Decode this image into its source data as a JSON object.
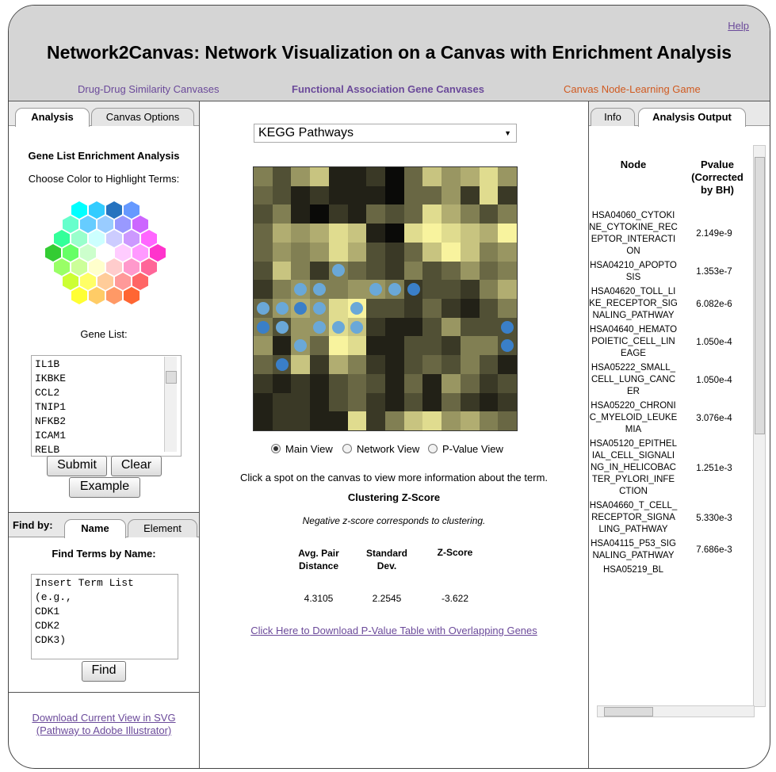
{
  "header": {
    "help": "Help",
    "title": "Network2Canvas: Network Visualization on a Canvas with Enrichment Analysis",
    "nav": [
      {
        "label": "Drug-Drug Similarity Canvases",
        "color": "#6b4a9a"
      },
      {
        "label": "Functional Association Gene Canvases",
        "color": "#6b4a9a"
      },
      {
        "label": "Canvas Node-Learning Game",
        "color": "#d05a20"
      }
    ]
  },
  "left": {
    "tabs": [
      "Analysis",
      "Canvas Options"
    ],
    "section_title": "Gene List Enrichment Analysis",
    "color_prompt": "Choose Color to Highlight Terms:",
    "gene_list_label": "Gene List:",
    "gene_list": "IL1B\nIKBKE\nCCL2\nTNIP1\nNFKB2\nICAM1\nRELB",
    "submit": "Submit",
    "clear": "Clear",
    "example": "Example",
    "find_by": "Find by:",
    "find_tabs": [
      "Name",
      "Element"
    ],
    "find_title": "Find Terms by Name:",
    "find_placeholder": "Insert Term List\n(e.g.,\nCDK1\nCDK2\nCDK3)",
    "find_button": "Find",
    "download_svg": "Download Current View in SVG",
    "download_svg_sub": "(Pathway to Adobe Illustrator)"
  },
  "center": {
    "select_value": "KEGG Pathways",
    "views": [
      "Main View",
      "Network View",
      "P-Value View"
    ],
    "selected_view": "Main View",
    "instruction": "Click a spot on the canvas to view more information about the term.",
    "clustering_title": "Clustering Z-Score",
    "clustering_note": "Negative z-score corresponds to clustering.",
    "stats_headers": [
      "Avg. Pair Distance",
      "Standard Dev.",
      "Z-Score"
    ],
    "stats_values": [
      "4.3105",
      "2.2545",
      "-3.622"
    ],
    "download_link": "Click Here to Download P-Value Table with Overlapping Genes"
  },
  "right": {
    "tabs": [
      "Info",
      "Analysis Output"
    ],
    "col_node": "Node",
    "col_pvalue": "Pvalue (Corrected by BH)",
    "rows": [
      {
        "node": "HSA04060_CYTOKINE_CYTOKINE_RECEPTOR_INTERACTION",
        "p": "2.149e-9"
      },
      {
        "node": "HSA04210_APOPTOSIS",
        "p": "1.353e-7"
      },
      {
        "node": "HSA04620_TOLL_LIKE_RECEPTOR_SIGNALING_PATHWAY",
        "p": "6.082e-6"
      },
      {
        "node": "HSA04640_HEMATOPOIETIC_CELL_LINEAGE",
        "p": "1.050e-4"
      },
      {
        "node": "HSA05222_SMALL_CELL_LUNG_CANCER",
        "p": "1.050e-4"
      },
      {
        "node": "HSA05220_CHRONIC_MYELOID_LEUKEMIA",
        "p": "3.076e-4"
      },
      {
        "node": "HSA05120_EPITHELIAL_CELL_SIGNALING_IN_HELICOBACTER_PYLORI_INFECTION",
        "p": "1.251e-3"
      },
      {
        "node": "HSA04660_T_CELL_RECEPTOR_SIGNALING_PATHWAY",
        "p": "5.330e-3"
      },
      {
        "node": "HSA04115_P53_SIGNALING_PATHWAY",
        "p": "7.686e-3"
      },
      {
        "node": "HSA05219_BL",
        "p": ""
      }
    ]
  },
  "canvas": {
    "levels": [
      [
        5,
        3,
        6,
        8,
        1,
        1,
        2,
        0,
        4,
        8,
        6,
        7,
        9,
        6
      ],
      [
        4,
        3,
        1,
        2,
        1,
        1,
        1,
        0,
        4,
        4,
        6,
        2,
        9,
        2
      ],
      [
        3,
        5,
        1,
        0,
        2,
        1,
        4,
        3,
        4,
        9,
        7,
        5,
        3,
        5
      ],
      [
        4,
        7,
        6,
        7,
        9,
        8,
        1,
        0,
        9,
        10,
        9,
        8,
        7,
        10
      ],
      [
        4,
        6,
        5,
        6,
        9,
        7,
        3,
        2,
        4,
        8,
        10,
        8,
        5,
        6
      ],
      [
        3,
        8,
        5,
        2,
        5,
        4,
        3,
        2,
        5,
        3,
        4,
        6,
        4,
        5
      ],
      [
        2,
        5,
        6,
        5,
        5,
        6,
        6,
        5,
        2,
        3,
        3,
        2,
        5,
        7
      ],
      [
        4,
        6,
        7,
        6,
        9,
        10,
        3,
        3,
        2,
        4,
        2,
        1,
        3,
        5
      ],
      [
        5,
        3,
        6,
        6,
        9,
        8,
        2,
        1,
        1,
        3,
        6,
        3,
        3,
        3
      ],
      [
        6,
        1,
        6,
        4,
        10,
        9,
        1,
        1,
        3,
        3,
        2,
        5,
        5,
        3
      ],
      [
        4,
        3,
        8,
        2,
        7,
        5,
        2,
        1,
        3,
        4,
        3,
        5,
        3,
        1
      ],
      [
        2,
        1,
        2,
        1,
        3,
        4,
        3,
        1,
        4,
        1,
        6,
        4,
        2,
        3
      ],
      [
        1,
        2,
        2,
        1,
        3,
        4,
        2,
        1,
        3,
        1,
        4,
        2,
        1,
        2
      ],
      [
        1,
        2,
        2,
        1,
        1,
        9,
        2,
        5,
        8,
        9,
        6,
        7,
        5,
        4
      ]
    ],
    "dots": [
      {
        "r": 5,
        "c": 4,
        "tone": "light"
      },
      {
        "r": 6,
        "c": 2,
        "tone": "light"
      },
      {
        "r": 6,
        "c": 3,
        "tone": "light"
      },
      {
        "r": 6,
        "c": 6,
        "tone": "light"
      },
      {
        "r": 6,
        "c": 7,
        "tone": "light"
      },
      {
        "r": 6,
        "c": 8,
        "tone": "dark"
      },
      {
        "r": 7,
        "c": 0,
        "tone": "light"
      },
      {
        "r": 7,
        "c": 1,
        "tone": "light"
      },
      {
        "r": 7,
        "c": 2,
        "tone": "dark"
      },
      {
        "r": 7,
        "c": 3,
        "tone": "light"
      },
      {
        "r": 7,
        "c": 5,
        "tone": "light"
      },
      {
        "r": 8,
        "c": 0,
        "tone": "dark"
      },
      {
        "r": 8,
        "c": 1,
        "tone": "light"
      },
      {
        "r": 8,
        "c": 3,
        "tone": "light"
      },
      {
        "r": 8,
        "c": 4,
        "tone": "light"
      },
      {
        "r": 8,
        "c": 5,
        "tone": "light"
      },
      {
        "r": 8,
        "c": 13,
        "tone": "dark"
      },
      {
        "r": 9,
        "c": 2,
        "tone": "light"
      },
      {
        "r": 9,
        "c": 13,
        "tone": "dark"
      },
      {
        "r": 10,
        "c": 1,
        "tone": "dark"
      }
    ]
  },
  "colors": {
    "link_purple": "#6b4a9a",
    "link_orange": "#d05a20",
    "dot_light": "#6aa8d8",
    "dot_dark": "#3a7fc8"
  }
}
